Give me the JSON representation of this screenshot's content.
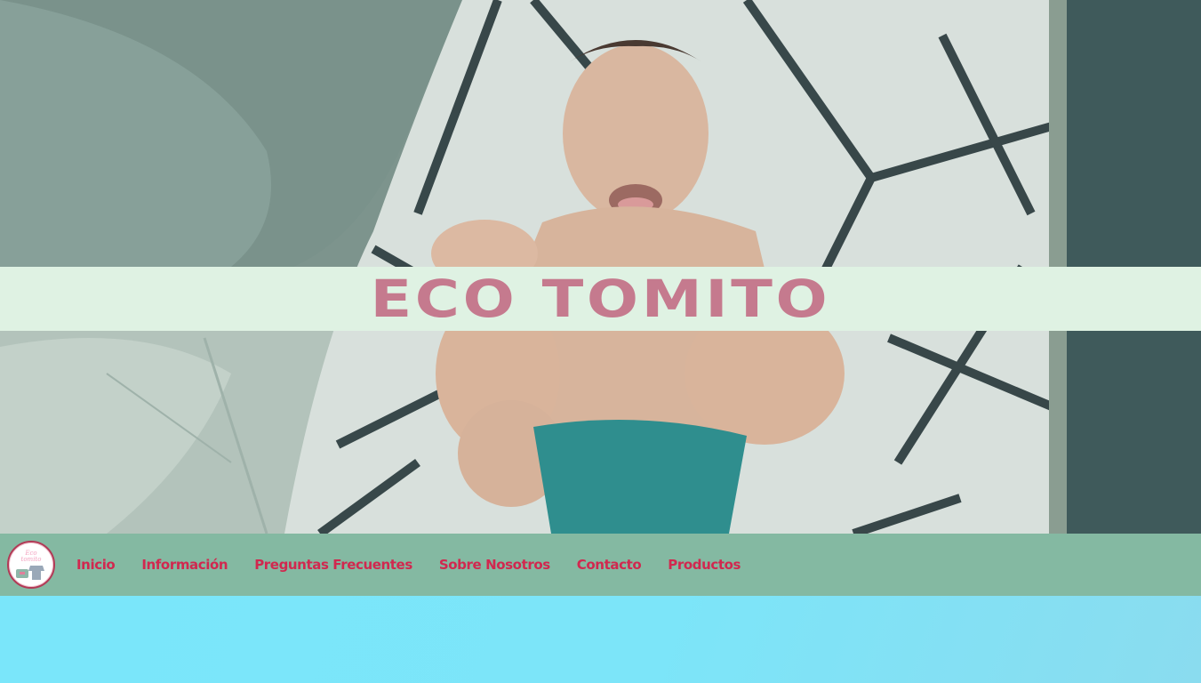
{
  "hero": {
    "title": "ECO TOMITO",
    "image": "smiling-baby-in-teal-cloth-diaper-on-blanket"
  },
  "nav": {
    "logo_lines": [
      "Eco",
      "tomito"
    ],
    "items": [
      {
        "label": "Inicio"
      },
      {
        "label": "Información"
      },
      {
        "label": "Preguntas Frecuentes"
      },
      {
        "label": "Sobre Nosotros"
      },
      {
        "label": "Contacto"
      },
      {
        "label": "Productos"
      }
    ]
  },
  "colors": {
    "title": "#c57a8e",
    "title_band": "#dff2e3",
    "nav_bg": "#84b9a2",
    "nav_text": "#d1284f",
    "lower_bg": "#7fe3f7"
  }
}
